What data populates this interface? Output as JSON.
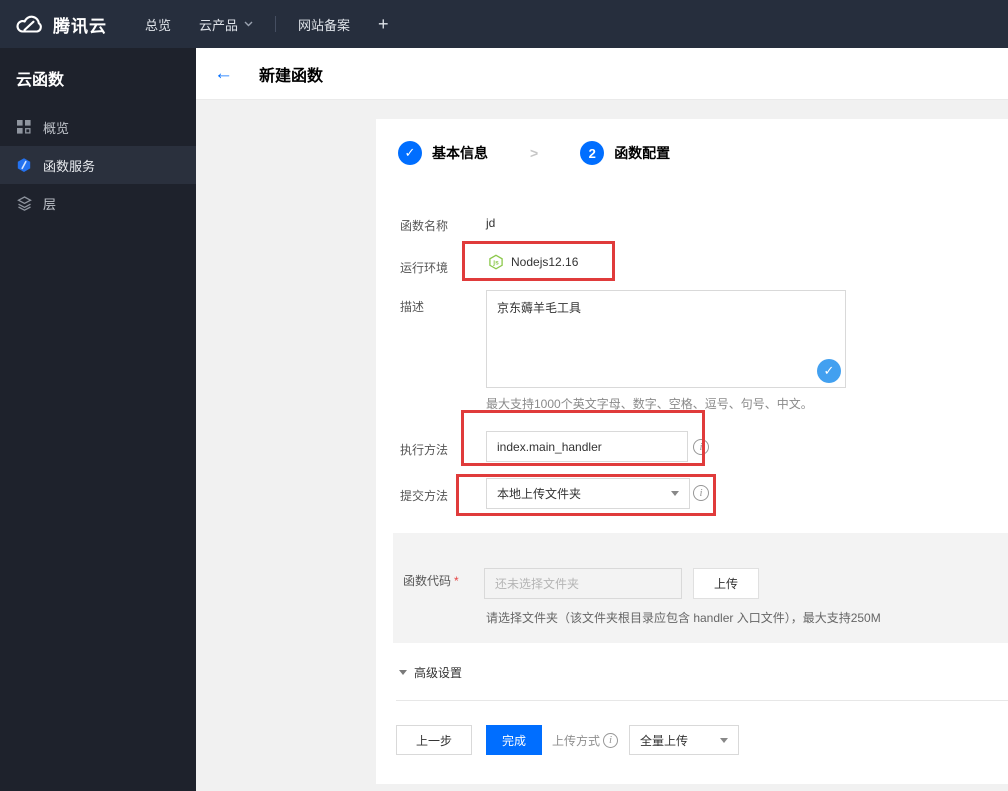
{
  "topbar": {
    "brand": "腾讯云",
    "nav": [
      {
        "label": "总览"
      },
      {
        "label": "云产品"
      },
      {
        "label": "网站备案"
      },
      {
        "label": "+"
      }
    ]
  },
  "sidebar": {
    "title": "云函数",
    "items": [
      {
        "label": "概览"
      },
      {
        "label": "函数服务"
      },
      {
        "label": "层"
      }
    ]
  },
  "header": {
    "back": "←",
    "title": "新建函数"
  },
  "steps": [
    {
      "num": "✓",
      "label": "基本信息"
    },
    {
      "num": "2",
      "label": "函数配置"
    }
  ],
  "form": {
    "name_label": "函数名称",
    "name_value": "jd",
    "runtime_label": "运行环境",
    "runtime_value": "Nodejs12.16",
    "desc_label": "描述",
    "desc_value": "京东薅羊毛工具",
    "desc_check": "✓",
    "desc_helper": "最大支持1000个英文字母、数字、空格、逗号、句号、中文。",
    "handler_label": "执行方法",
    "handler_value": "index.main_handler",
    "submit_label": "提交方法",
    "submit_value": "本地上传文件夹",
    "code_label": "函数代码",
    "code_required": "*",
    "code_placeholder": "还未选择文件夹",
    "upload_button": "上传",
    "code_helper": "请选择文件夹（该文件夹根目录应包含 handler 入口文件），最大支持250M",
    "advanced_label": "高级设置"
  },
  "footer": {
    "prev": "上一步",
    "finish": "完成",
    "upload_mode_label": "上传方式",
    "upload_mode_value": "全量上传"
  },
  "colors": {
    "accent": "#006eff",
    "annotation_red": "#e03b3b",
    "node_green": "#8cc84b",
    "valid_check_blue": "#42a0f0",
    "topbar_bg": "#262e3d",
    "sidebar_bg": "#1e222c"
  }
}
